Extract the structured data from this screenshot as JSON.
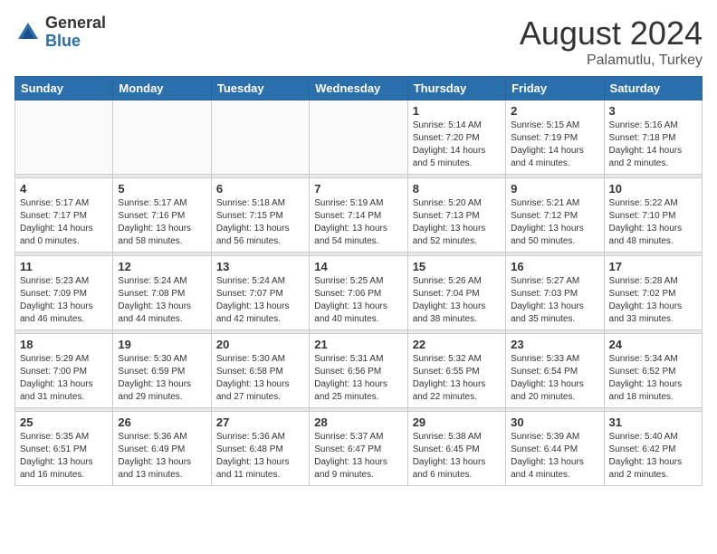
{
  "header": {
    "logo_general": "General",
    "logo_blue": "Blue",
    "title": "August 2024",
    "subtitle": "Palamutlu, Turkey"
  },
  "days_of_week": [
    "Sunday",
    "Monday",
    "Tuesday",
    "Wednesday",
    "Thursday",
    "Friday",
    "Saturday"
  ],
  "weeks": [
    [
      {
        "day": "",
        "info": ""
      },
      {
        "day": "",
        "info": ""
      },
      {
        "day": "",
        "info": ""
      },
      {
        "day": "",
        "info": ""
      },
      {
        "day": "1",
        "info": "Sunrise: 5:14 AM\nSunset: 7:20 PM\nDaylight: 14 hours\nand 5 minutes."
      },
      {
        "day": "2",
        "info": "Sunrise: 5:15 AM\nSunset: 7:19 PM\nDaylight: 14 hours\nand 4 minutes."
      },
      {
        "day": "3",
        "info": "Sunrise: 5:16 AM\nSunset: 7:18 PM\nDaylight: 14 hours\nand 2 minutes."
      }
    ],
    [
      {
        "day": "4",
        "info": "Sunrise: 5:17 AM\nSunset: 7:17 PM\nDaylight: 14 hours\nand 0 minutes."
      },
      {
        "day": "5",
        "info": "Sunrise: 5:17 AM\nSunset: 7:16 PM\nDaylight: 13 hours\nand 58 minutes."
      },
      {
        "day": "6",
        "info": "Sunrise: 5:18 AM\nSunset: 7:15 PM\nDaylight: 13 hours\nand 56 minutes."
      },
      {
        "day": "7",
        "info": "Sunrise: 5:19 AM\nSunset: 7:14 PM\nDaylight: 13 hours\nand 54 minutes."
      },
      {
        "day": "8",
        "info": "Sunrise: 5:20 AM\nSunset: 7:13 PM\nDaylight: 13 hours\nand 52 minutes."
      },
      {
        "day": "9",
        "info": "Sunrise: 5:21 AM\nSunset: 7:12 PM\nDaylight: 13 hours\nand 50 minutes."
      },
      {
        "day": "10",
        "info": "Sunrise: 5:22 AM\nSunset: 7:10 PM\nDaylight: 13 hours\nand 48 minutes."
      }
    ],
    [
      {
        "day": "11",
        "info": "Sunrise: 5:23 AM\nSunset: 7:09 PM\nDaylight: 13 hours\nand 46 minutes."
      },
      {
        "day": "12",
        "info": "Sunrise: 5:24 AM\nSunset: 7:08 PM\nDaylight: 13 hours\nand 44 minutes."
      },
      {
        "day": "13",
        "info": "Sunrise: 5:24 AM\nSunset: 7:07 PM\nDaylight: 13 hours\nand 42 minutes."
      },
      {
        "day": "14",
        "info": "Sunrise: 5:25 AM\nSunset: 7:06 PM\nDaylight: 13 hours\nand 40 minutes."
      },
      {
        "day": "15",
        "info": "Sunrise: 5:26 AM\nSunset: 7:04 PM\nDaylight: 13 hours\nand 38 minutes."
      },
      {
        "day": "16",
        "info": "Sunrise: 5:27 AM\nSunset: 7:03 PM\nDaylight: 13 hours\nand 35 minutes."
      },
      {
        "day": "17",
        "info": "Sunrise: 5:28 AM\nSunset: 7:02 PM\nDaylight: 13 hours\nand 33 minutes."
      }
    ],
    [
      {
        "day": "18",
        "info": "Sunrise: 5:29 AM\nSunset: 7:00 PM\nDaylight: 13 hours\nand 31 minutes."
      },
      {
        "day": "19",
        "info": "Sunrise: 5:30 AM\nSunset: 6:59 PM\nDaylight: 13 hours\nand 29 minutes."
      },
      {
        "day": "20",
        "info": "Sunrise: 5:30 AM\nSunset: 6:58 PM\nDaylight: 13 hours\nand 27 minutes."
      },
      {
        "day": "21",
        "info": "Sunrise: 5:31 AM\nSunset: 6:56 PM\nDaylight: 13 hours\nand 25 minutes."
      },
      {
        "day": "22",
        "info": "Sunrise: 5:32 AM\nSunset: 6:55 PM\nDaylight: 13 hours\nand 22 minutes."
      },
      {
        "day": "23",
        "info": "Sunrise: 5:33 AM\nSunset: 6:54 PM\nDaylight: 13 hours\nand 20 minutes."
      },
      {
        "day": "24",
        "info": "Sunrise: 5:34 AM\nSunset: 6:52 PM\nDaylight: 13 hours\nand 18 minutes."
      }
    ],
    [
      {
        "day": "25",
        "info": "Sunrise: 5:35 AM\nSunset: 6:51 PM\nDaylight: 13 hours\nand 16 minutes."
      },
      {
        "day": "26",
        "info": "Sunrise: 5:36 AM\nSunset: 6:49 PM\nDaylight: 13 hours\nand 13 minutes."
      },
      {
        "day": "27",
        "info": "Sunrise: 5:36 AM\nSunset: 6:48 PM\nDaylight: 13 hours\nand 11 minutes."
      },
      {
        "day": "28",
        "info": "Sunrise: 5:37 AM\nSunset: 6:47 PM\nDaylight: 13 hours\nand 9 minutes."
      },
      {
        "day": "29",
        "info": "Sunrise: 5:38 AM\nSunset: 6:45 PM\nDaylight: 13 hours\nand 6 minutes."
      },
      {
        "day": "30",
        "info": "Sunrise: 5:39 AM\nSunset: 6:44 PM\nDaylight: 13 hours\nand 4 minutes."
      },
      {
        "day": "31",
        "info": "Sunrise: 5:40 AM\nSunset: 6:42 PM\nDaylight: 13 hours\nand 2 minutes."
      }
    ]
  ]
}
